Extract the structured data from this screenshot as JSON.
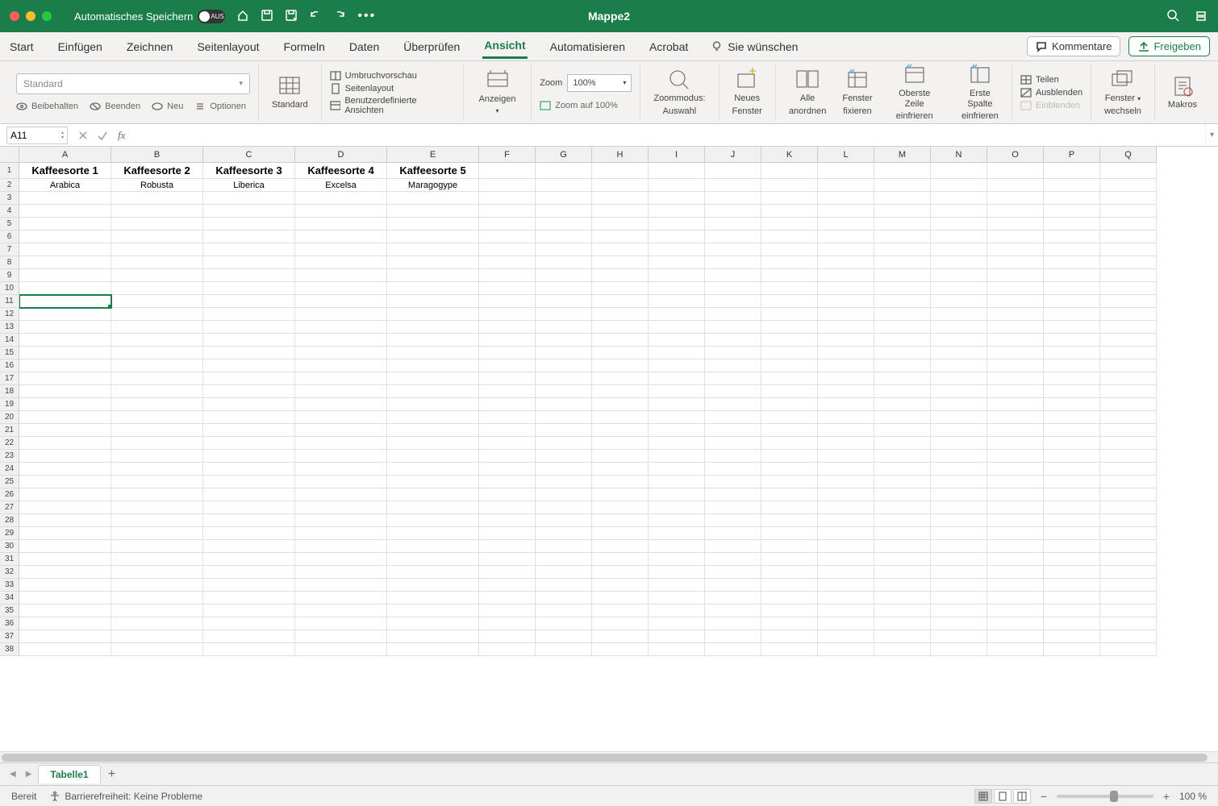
{
  "titlebar": {
    "autosave_label": "Automatisches Speichern",
    "autosave_state": "AUS",
    "title": "Mappe2"
  },
  "tabs": {
    "items": [
      "Start",
      "Einfügen",
      "Zeichnen",
      "Seitenlayout",
      "Formeln",
      "Daten",
      "Überprüfen",
      "Ansicht",
      "Automatisieren",
      "Acrobat"
    ],
    "active_index": 7,
    "tell_me": "Sie wünschen",
    "comments_btn": "Kommentare",
    "share_btn": "Freigeben"
  },
  "ribbon": {
    "style_select": "Standard",
    "keep": "Beibehalten",
    "exit": "Beenden",
    "new": "Neu",
    "options": "Optionen",
    "standard": "Standard",
    "page_break": "Umbruchvorschau",
    "page_layout": "Seitenlayout",
    "custom_views": "Benutzerdefinierte Ansichten",
    "show": "Anzeigen",
    "zoom_lbl": "Zoom",
    "zoom_val": "100%",
    "zoom_100": "Zoom auf 100%",
    "zoom_mode1": "Zoommodus:",
    "zoom_mode2": "Auswahl",
    "new_window1": "Neues",
    "new_window2": "Fenster",
    "arrange1": "Alle",
    "arrange2": "anordnen",
    "freeze1": "Fenster",
    "freeze2": "fixieren",
    "freeze_top1": "Oberste Zeile",
    "freeze_top2": "einfrieren",
    "freeze_col1": "Erste Spalte",
    "freeze_col2": "einfrieren",
    "split": "Teilen",
    "hide": "Ausblenden",
    "unhide": "Einblenden",
    "switch1": "Fenster",
    "switch2": "wechseln",
    "macros": "Makros"
  },
  "formula": {
    "name_box": "A11",
    "value": ""
  },
  "grid": {
    "columns": [
      "A",
      "B",
      "C",
      "D",
      "E",
      "F",
      "G",
      "H",
      "I",
      "J",
      "K",
      "L",
      "M",
      "N",
      "O",
      "P",
      "Q"
    ],
    "wide_count": 5,
    "row_count": 38,
    "header_row": [
      "Kaffeesorte 1",
      "Kaffeesorte 2",
      "Kaffeesorte 3",
      "Kaffeesorte 4",
      "Kaffeesorte 5"
    ],
    "data_row": [
      "Arabica",
      "Robusta",
      "Liberica",
      "Excelsa",
      "Maragogype"
    ],
    "selected": {
      "row": 11,
      "col": 0
    }
  },
  "sheettabs": {
    "name": "Tabelle1"
  },
  "status": {
    "ready": "Bereit",
    "a11y": "Barrierefreiheit: Keine Probleme",
    "zoom_pct": "100 %"
  }
}
